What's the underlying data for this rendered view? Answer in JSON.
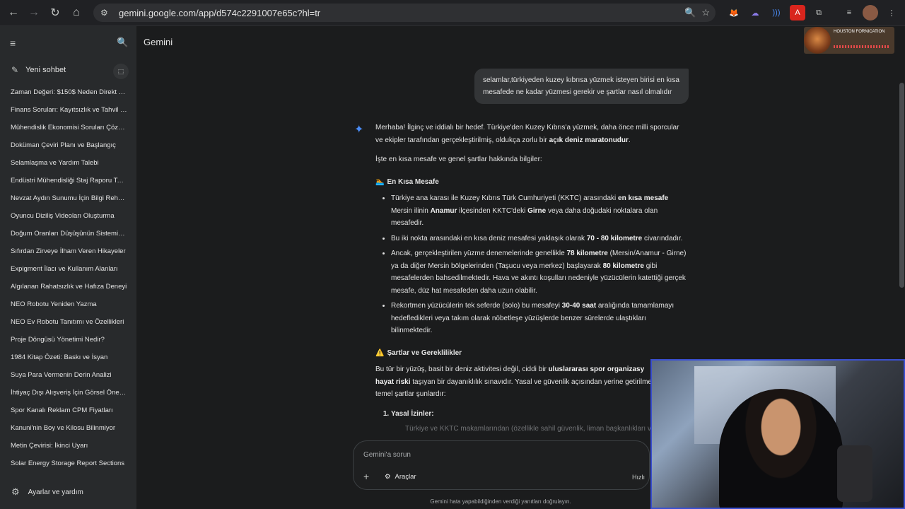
{
  "browser": {
    "url": "gemini.google.com/app/d574c2291007e65c?hl=tr"
  },
  "sidebar": {
    "new_chat": "Yeni sohbet",
    "history": [
      "Zaman Değeri: $150$ Neden Direkt K...",
      "Finans Soruları: Kayıtsızlık ve Tahvil Fi...",
      "Mühendislik Ekonomisi Soruları Çözü...",
      "Doküman Çeviri Planı ve Başlangıç",
      "Selamlaşma ve Yardım Talebi",
      "Endüstri Mühendisliği Staj Raporu Tas...",
      "Nevzat Aydın Sunumu İçin Bilgi Rehberi",
      "Oyuncu Diziliş Videoları Oluşturma",
      "Doğum Oranları Düşüşünün Sistemik ...",
      "Sıfırdan Zirveye İlham Veren Hikayeler",
      "Expigment İlacı ve Kullanım Alanları",
      "Algılanan Rahatsızlık ve Hafıza Deneyi",
      "NEO Robotu Yeniden Yazma",
      "NEO Ev Robotu Tanıtımı ve Özellikleri",
      "Proje Döngüsü Yönetimi Nedir?",
      "1984 Kitap Özeti: Baskı ve İsyan",
      "Suya Para Vermenin Derin Analizi",
      "İhtiyaç Dışı Alışveriş İçin Görsel Öneril...",
      "Spor Kanalı Reklam CPM Fiyatları",
      "Kanuni'nin Boy ve Kilosu Bilinmiyor",
      "Metin Çevirisi: İkinci Uyarı",
      "Solar Energy Storage Report Sections"
    ],
    "settings": "Ayarlar ve yardım"
  },
  "app_title": "Gemini",
  "user_message": "selamlar,türkiyeden kuzey kıbrısa yüzmek isteyen birisi en kısa mesafede ne kadar yüzmesi gerekir ve şartlar nasıl olmalıdır",
  "answer": {
    "intro_a": "Merhaba! İlginç ve iddialı bir hedef. Türkiye'den Kuzey Kıbrıs'a yüzmek, daha önce milli sporcular ve ekipler tarafından gerçekleştirilmiş, oldukça zorlu bir ",
    "intro_b": "açık deniz maratonudur",
    "intro_c": ".",
    "lead": "İşte en kısa mesafe ve genel şartlar hakkında bilgiler:",
    "section1_emoji": "🏊",
    "section1": "En Kısa Mesafe",
    "b1_a": "Türkiye ana karası ile Kuzey Kıbrıs Türk Cumhuriyeti (KKTC) arasındaki ",
    "b1_b": "en kısa mesafe",
    "b1_c": " Mersin ilinin ",
    "b1_d": "Anamur",
    "b1_e": " ilçesinden KKTC'deki ",
    "b1_f": "Girne",
    "b1_g": " veya daha doğudaki noktalara olan mesafedir.",
    "b2_a": "Bu iki nokta arasındaki en kısa deniz mesafesi yaklaşık olarak ",
    "b2_b": "70 - 80 kilometre",
    "b2_c": " civarındadır.",
    "b3_a": "Ancak, gerçekleştirilen yüzme denemelerinde genellikle ",
    "b3_b": "78 kilometre",
    "b3_c": " (Mersin/Anamur - Girne) ya da diğer Mersin bölgelerinden (Taşucu veya merkez) başlayarak ",
    "b3_d": "80 kilometre",
    "b3_e": " gibi mesafelerden bahsedilmektedir. Hava ve akıntı koşulları nedeniyle yüzücülerin katettiği gerçek mesafe, düz hat mesafeden daha uzun olabilir.",
    "b4_a": "Rekortmen yüzücülerin tek seferde (solo) bu mesafeyi ",
    "b4_b": "30-40 saat",
    "b4_c": " aralığında tamamlamayı hedefledikleri veya takım olarak nöbetleşe yüzüşlerde benzer sürelerde ulaştıkları bilinmektedir.",
    "section2_emoji": "⚠️",
    "section2": "Şartlar ve Gereklilikler",
    "p2_a": "Bu tür bir yüzüş, basit bir deniz aktivitesi değil, ciddi bir ",
    "p2_b": "uluslararası spor organizasy",
    "p2_c": "hayat riski",
    "p2_d": " taşıyan bir dayanıklılık sınavıdır. Yasal ve güvenlik açısından yerine getirilme",
    "p2_e": "temel şartlar şunlardır:",
    "ol1": "Yasal İzinler:",
    "faded": "Türkiye ve KKTC makamlarından (özellikle sahil güvenlik, liman başkanlıkları ve..."
  },
  "composer": {
    "placeholder": "Gemini'a sorun",
    "tools": "Araçlar",
    "mode": "Hızlı"
  },
  "disclaimer": "Gemini hata yapabildiğinden verdiği yanıtları doğrulayın.",
  "stream_overlay": {
    "label": "HOUSTON FORNICATION"
  }
}
